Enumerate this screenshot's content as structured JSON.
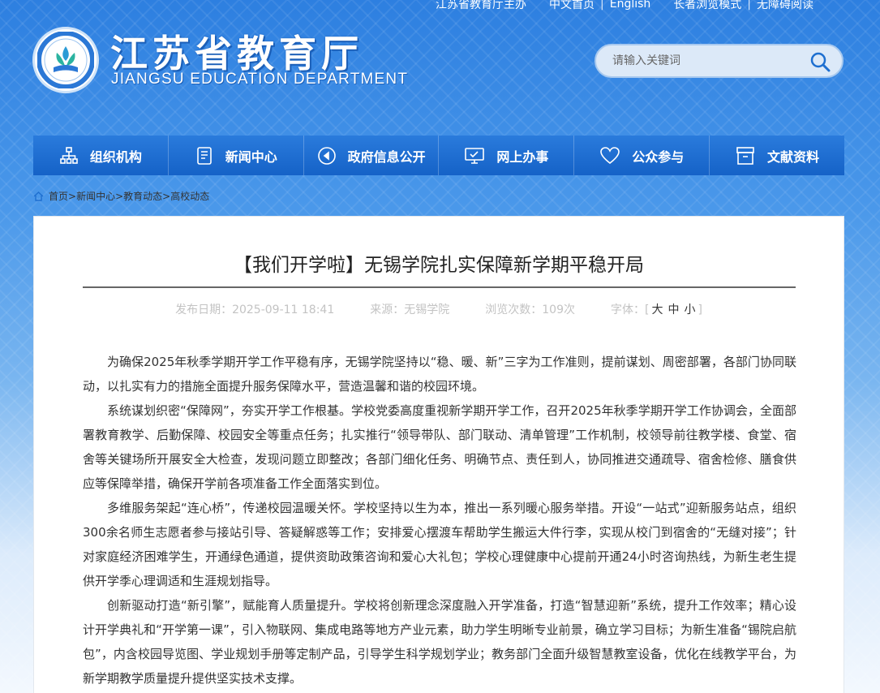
{
  "top_links": [
    "江苏省教育厅主办",
    "中文首页",
    "English",
    "长者浏览模式",
    "无障碍阅读"
  ],
  "logo": {
    "cn": "江苏省教育厅",
    "en": "JIANGSU EDUCATION DEPARTMENT"
  },
  "search": {
    "placeholder": "请输入关键词"
  },
  "nav": [
    {
      "label": "组织机构",
      "icon": "org-chart-icon"
    },
    {
      "label": "新闻中心",
      "icon": "news-document-icon"
    },
    {
      "label": "政府信息公开",
      "icon": "compass-icon"
    },
    {
      "label": "网上办事",
      "icon": "monitor-icon"
    },
    {
      "label": "公众参与",
      "icon": "heart-icon"
    },
    {
      "label": "文献资料",
      "icon": "archive-box-icon"
    }
  ],
  "breadcrumb": [
    "首页",
    "新闻中心",
    "教育动态",
    "高校动态"
  ],
  "article": {
    "title": "【我们开学啦】无锡学院扎实保障新学期平稳开局",
    "meta": {
      "date_label": "发布日期：",
      "date": "2025-09-11 18:41",
      "source_label": "来源：",
      "source": "无锡学院",
      "views_label": "浏览次数：",
      "views": "109次",
      "font_label": "字体：",
      "font_sizes": [
        "大",
        "中",
        "小"
      ]
    },
    "paragraphs": [
      "为确保2025年秋季学期开学工作平稳有序，无锡学院坚持以“稳、暖、新”三字为工作准则，提前谋划、周密部署，各部门协同联动，以扎实有力的措施全面提升服务保障水平，营造温馨和谐的校园环境。",
      "系统谋划织密“保障网”，夯实开学工作根基。学校党委高度重视新学期开学工作，召开2025年秋季学期开学工作协调会，全面部署教育教学、后勤保障、校园安全等重点任务；扎实推行“领导带队、部门联动、清单管理”工作机制，校领导前往教学楼、食堂、宿舍等关键场所开展安全大检查，发现问题立即整改；各部门细化任务、明确节点、责任到人，协同推进交通疏导、宿舍检修、膳食供应等保障举措，确保开学前各项准备工作全面落实到位。",
      "多维服务架起“连心桥”，传递校园温暖关怀。学校坚持以生为本，推出一系列暖心服务举措。开设“一站式”迎新服务站点，组织300余名师生志愿者参与接站引导、答疑解惑等工作；安排爱心摆渡车帮助学生搬运大件行李，实现从校门到宿舍的“无缝对接”；针对家庭经济困难学生，开通绿色通道，提供资助政策咨询和爱心大礼包；学校心理健康中心提前开通24小时咨询热线，为新生老生提供开学季心理调适和生涯规划指导。",
      "创新驱动打造“新引擎”，赋能育人质量提升。学校将创新理念深度融入开学准备，打造“智慧迎新”系统，提升工作效率；精心设计开学典礼和“开学第一课”，引入物联网、集成电路等地方产业元素，助力学生明晰专业前景，确立学习目标；为新生准备“锡院启航包”，内含校园导览图、学业规划手册等定制产品，引导学生科学规划学业；教务部门全面升级智慧教室设备，优化在线教学平台，为新学期教学质量提升提供坚实技术支撑。"
    ]
  }
}
